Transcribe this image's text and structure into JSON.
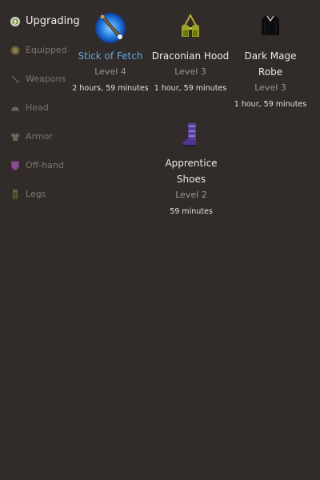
{
  "sidebar": {
    "items": [
      {
        "label": "Upgrading",
        "icon": "upgrade-icon",
        "active": true
      },
      {
        "label": "Equipped",
        "icon": "equipped-icon",
        "active": false
      },
      {
        "label": "Weapons",
        "icon": "weapons-icon",
        "active": false
      },
      {
        "label": "Head",
        "icon": "head-icon",
        "active": false
      },
      {
        "label": "Armor",
        "icon": "armor-icon",
        "active": false
      },
      {
        "label": "Off-hand",
        "icon": "off-hand-icon",
        "active": false
      },
      {
        "label": "Legs",
        "icon": "legs-icon",
        "active": false
      }
    ]
  },
  "upgrades": [
    {
      "name": "Stick of Fetch",
      "level": "Level 4",
      "time": "2 hours, 59 minutes",
      "icon": "staff-icon",
      "highlight": true
    },
    {
      "name": "Draconian Hood",
      "level": "Level 3",
      "time": "1 hour, 59 minutes",
      "icon": "hood-icon",
      "highlight": false
    },
    {
      "name": "Dark Mage Robe",
      "level": "Level 3",
      "time": "1 hour, 59 minutes",
      "icon": "robe-icon",
      "highlight": false
    },
    {
      "name": "Apprentice Shoes",
      "level": "Level 2",
      "time": "59 minutes",
      "icon": "boots-icon",
      "highlight": false
    }
  ],
  "colors": {
    "background": "#312c29",
    "active_text": "#f2efe9",
    "inactive_text": "#7d7770",
    "highlight": "#63a7df"
  }
}
